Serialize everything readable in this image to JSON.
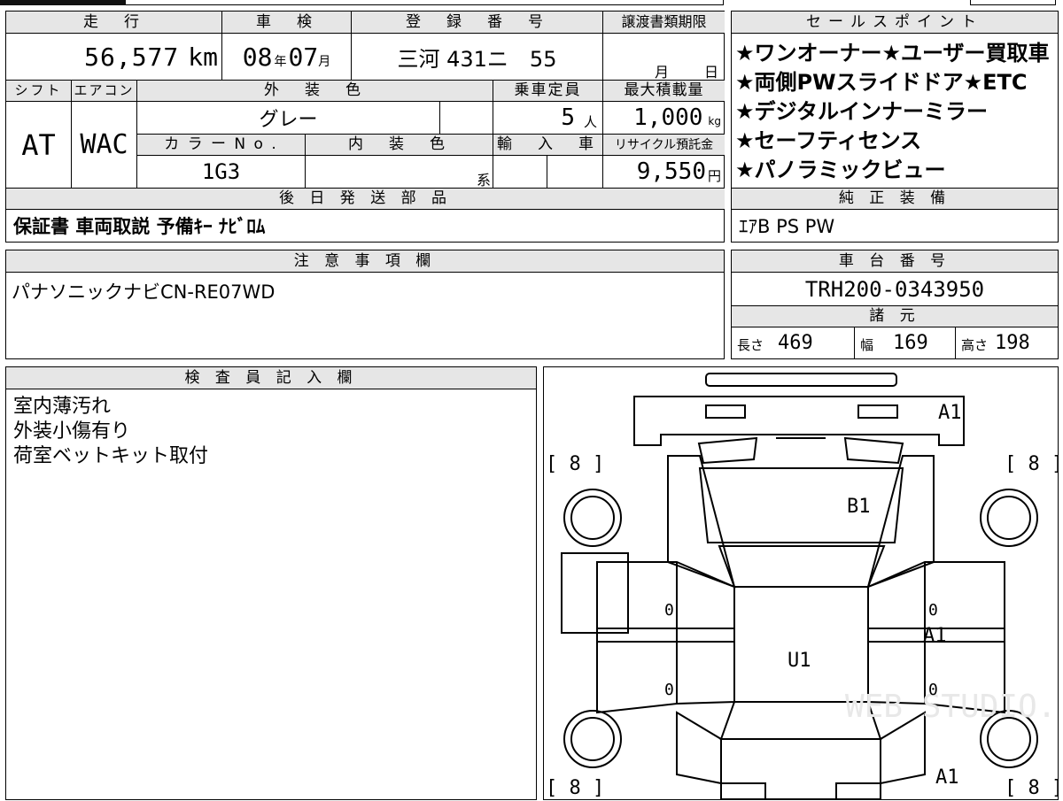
{
  "top_row": {
    "mileage_label": "走　行",
    "mileage_value": "56,577",
    "mileage_unit": "km",
    "inspection_label": "車　検",
    "inspection_year": "08",
    "inspection_year_unit": "年",
    "inspection_month": "07",
    "inspection_month_unit": "月",
    "registration_label": "登　録　番　号",
    "registration_value": "三河 431ニ　55",
    "transfer_label": "譲渡書類期限",
    "transfer_month": "月",
    "transfer_day": "日"
  },
  "second_row": {
    "shift_label": "シフト",
    "shift_value": "AT",
    "aircon_label": "エアコン",
    "aircon_value": "WAC",
    "exterior_color_label": "外　装　色",
    "exterior_color_value": "グレー",
    "capacity_label": "乗車定員",
    "capacity_value": "5",
    "capacity_unit": "人",
    "max_load_label": "最大積載量",
    "max_load_value": "1,000",
    "max_load_unit": "kg",
    "color_no_label": "カ ラ ー N o .",
    "color_no_value": "1G3",
    "interior_color_label": "内　装　色",
    "interior_color_suffix": "系",
    "import_label": "輸　入　車",
    "recycle_label": "リサイクル預託金",
    "recycle_value": "9,550",
    "recycle_unit": "円"
  },
  "later_parts": {
    "label": "後 日 発 送 部 品",
    "value": "保証書 車両取説 予備ｷｰ ﾅﾋﾞﾛﾑ"
  },
  "sales_points": {
    "label": "セールスポイント",
    "items": [
      "★ワンオーナー★ユーザー買取車",
      "★両側PWスライドドア★ETC",
      "★デジタルインナーミラー",
      "★セーフティセンス",
      "★パノラミックビュー"
    ]
  },
  "genuine_equipment": {
    "label": "純 正 装 備",
    "value": "ｴｱB PS PW"
  },
  "notes": {
    "label": "注 意 事 項 欄",
    "value": "パナソニックナビCN-RE07WD"
  },
  "chassis": {
    "label": "車 台 番 号",
    "value": "TRH200-0343950"
  },
  "specs": {
    "label": "諸 元",
    "length_label": "長さ",
    "length_value": "469",
    "width_label": "幅",
    "width_value": "169",
    "height_label": "高さ",
    "height_value": "198"
  },
  "inspector": {
    "label": "検 査 員 記 入 欄",
    "lines": [
      "室内薄汚れ",
      "外装小傷有り",
      "荷室ベットキット取付"
    ]
  },
  "diagram": {
    "tire_fl": "[ 8 ]",
    "tire_fr": "[ 8 ]",
    "tire_rl": "[ 8 ]",
    "tire_rr": "[ 8 ]",
    "front_bumper": "A1",
    "hood": "B1",
    "roof": "U1",
    "right_side": "A1",
    "rear_right": "A1",
    "left_door_front": "0",
    "left_door_rear": "0",
    "right_door_front": "0",
    "right_door_rear": "0",
    "watermark": "WEB STUDIO.JP"
  }
}
